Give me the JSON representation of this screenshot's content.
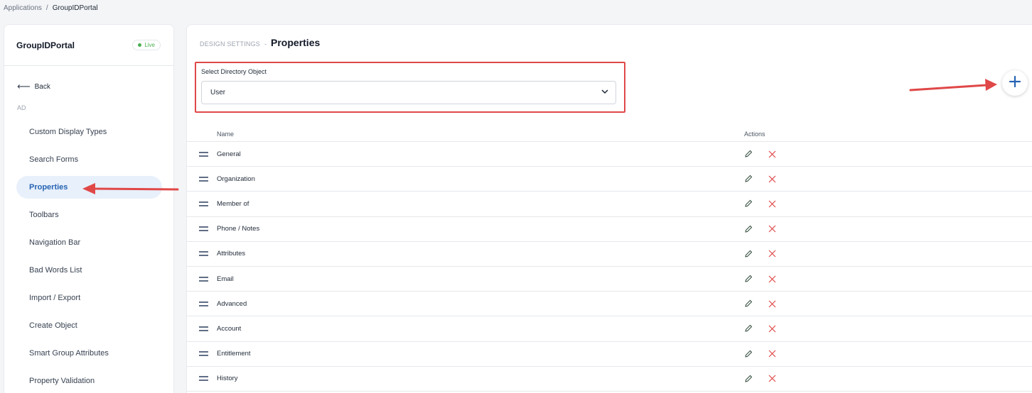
{
  "breadcrumb": {
    "root": "Applications",
    "separator": "/",
    "current": "GroupIDPortal"
  },
  "sidebar": {
    "app_name": "GroupIDPortal",
    "status": "Live",
    "back_label": "Back",
    "section": "AD",
    "items": [
      {
        "label": "Custom Display Types"
      },
      {
        "label": "Search Forms"
      },
      {
        "label": "Properties",
        "active": true
      },
      {
        "label": "Toolbars"
      },
      {
        "label": "Navigation Bar"
      },
      {
        "label": "Bad Words List"
      },
      {
        "label": "Import / Export"
      },
      {
        "label": "Create Object"
      },
      {
        "label": "Smart Group Attributes"
      },
      {
        "label": "Property Validation"
      }
    ]
  },
  "main": {
    "section_label": "DESIGN SETTINGS",
    "separator": "-",
    "title": "Properties",
    "select_label": "Select Directory Object",
    "select_value": "User",
    "table": {
      "headers": {
        "name": "Name",
        "actions": "Actions"
      },
      "rows": [
        "General",
        "Organization",
        "Member of",
        "Phone / Notes",
        "Attributes",
        "Email",
        "Advanced",
        "Account",
        "Entitlement",
        "History"
      ]
    }
  },
  "icons": {
    "back": "arrow-left-icon",
    "dropdown": "chevron-down-icon",
    "add": "plus-icon",
    "drag": "drag-handle-icon",
    "edit": "pencil-icon",
    "delete": "close-icon"
  },
  "colors": {
    "accent": "#2563b3",
    "live": "#4caf50",
    "delete": "#e04848",
    "annotation": "#e04848"
  }
}
